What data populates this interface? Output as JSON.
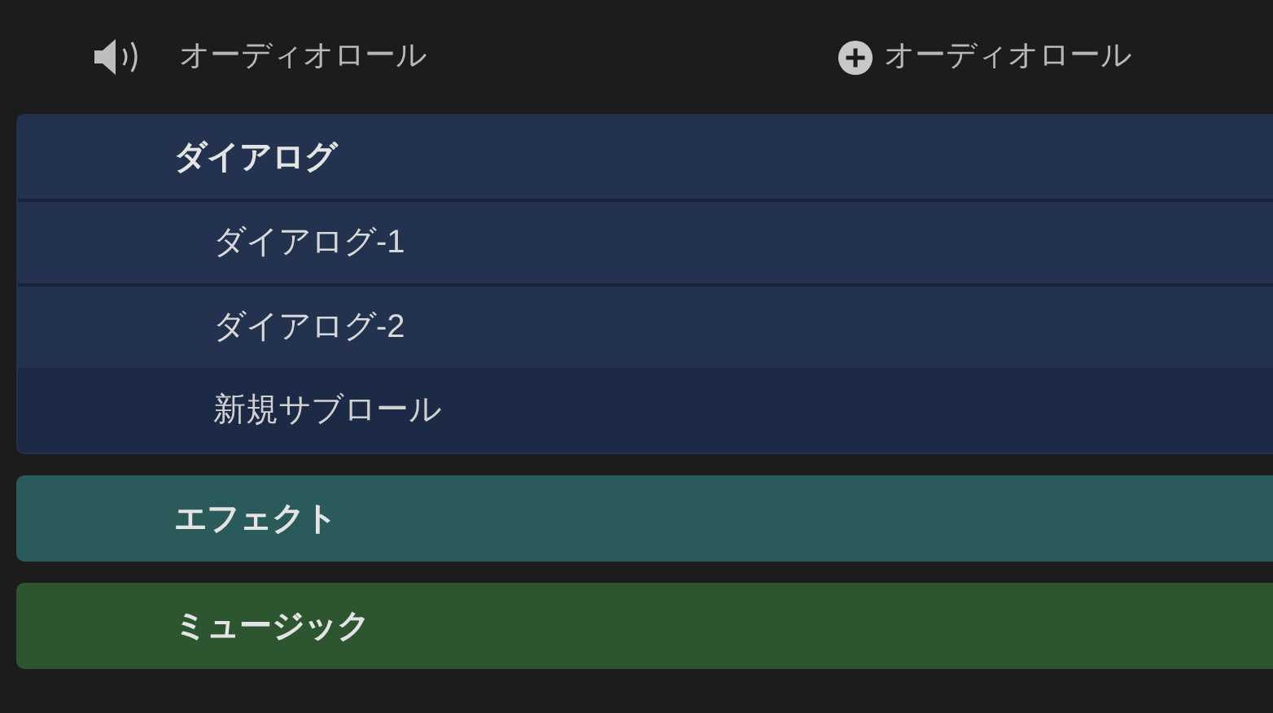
{
  "header": {
    "column_label": "オーディオロール",
    "add_button": "オーディオロール"
  },
  "roles": [
    {
      "name": "ダイアログ",
      "color": "#22324f",
      "children": [
        {
          "name": "ダイアログ-1",
          "kind": "subrole"
        },
        {
          "name": "ダイアログ-2",
          "kind": "subrole"
        },
        {
          "name": "新規サブロール",
          "kind": "new"
        }
      ]
    },
    {
      "name": "エフェクト",
      "color": "#2b5a5b"
    },
    {
      "name": "ミュージック",
      "color": "#2c5530"
    }
  ]
}
